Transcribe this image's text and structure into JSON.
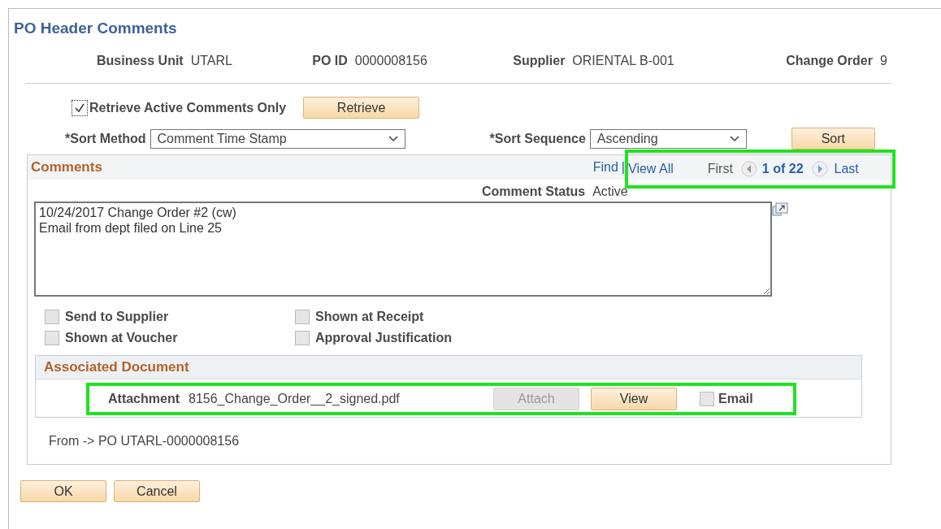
{
  "title": "PO Header Comments",
  "header_fields": [
    {
      "label": "Business Unit",
      "value": "UTARL"
    },
    {
      "label": "PO ID",
      "value": "0000008156"
    },
    {
      "label": "Supplier",
      "value": "ORIENTAL B-001"
    },
    {
      "label": "Change Order",
      "value": "9"
    }
  ],
  "retrieve": {
    "checkbox": {
      "label": "Retrieve Active Comments Only",
      "checked": true
    },
    "button": "Retrieve"
  },
  "sort": {
    "method": {
      "label": "*Sort Method",
      "value": "Comment Time Stamp"
    },
    "sequence": {
      "label": "*Sort Sequence",
      "value": "Ascending"
    },
    "button": "Sort"
  },
  "comments": {
    "title": "Comments",
    "find": "Find",
    "separator": "|",
    "view_all": "View All",
    "first": "First",
    "position": "1 of 22",
    "last": "Last",
    "status": {
      "label": "Comment Status",
      "value": "Active"
    },
    "text": "10/24/2017 Change Order #2 (cw)\nEmail from dept filed on Line 25",
    "options": [
      {
        "label": "Send to Supplier",
        "checked": false,
        "disabled": true
      },
      {
        "label": "Shown at Receipt",
        "checked": false,
        "disabled": true
      },
      {
        "label": "Shown at Voucher",
        "checked": false,
        "disabled": true
      },
      {
        "label": "Approval Justification",
        "checked": false,
        "disabled": true
      }
    ],
    "associated": {
      "title": "Associated Document",
      "label": "Attachment",
      "file": "8156_Change_Order__2_signed.pdf",
      "buttons": [
        {
          "label": "Attach",
          "disabled": true
        },
        {
          "label": "View",
          "disabled": false
        }
      ],
      "email": {
        "label": "Email",
        "checked": false,
        "disabled": true
      }
    },
    "from": "From -> PO UTARL-0000008156"
  },
  "buttons": [
    "OK",
    "Cancel"
  ]
}
